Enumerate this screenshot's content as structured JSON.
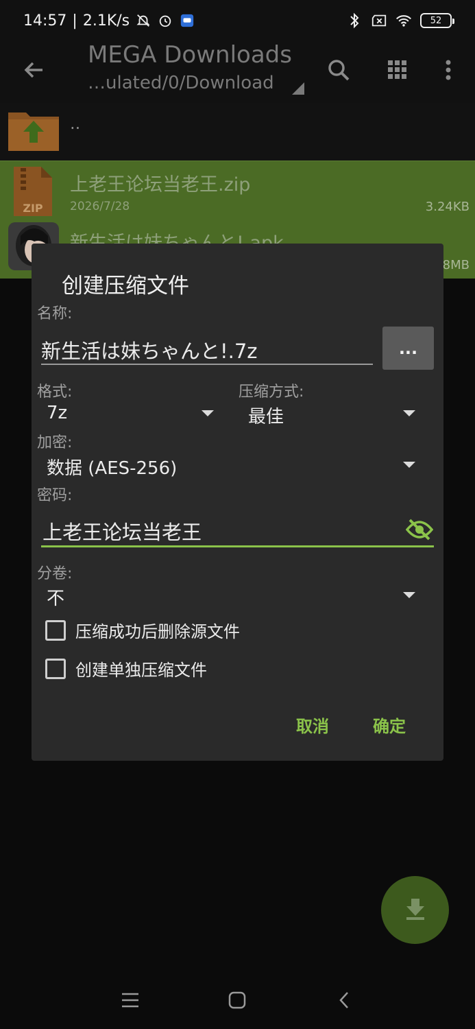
{
  "status_bar": {
    "time": "14:57",
    "net_speed": "2.1K/s",
    "battery": "52",
    "icons": [
      "bell-off-icon",
      "alarm-icon",
      "app-badge-icon",
      "bluetooth-icon",
      "sim-x-icon",
      "wifi-icon",
      "battery-icon"
    ]
  },
  "toolbar": {
    "title": "MEGA Downloads",
    "path": "…ulated/0/Download",
    "icons": [
      "back-arrow-icon",
      "search-icon",
      "grid-view-icon",
      "more-vert-icon"
    ]
  },
  "file_list": {
    "parent_label": "..",
    "files": [
      {
        "name": "上老王论坛当老王.zip",
        "date": "2026/7/28",
        "size": "3.24KB",
        "icon": "zip-file-icon"
      },
      {
        "name": "新生活は妹ちゃんと!.apk",
        "date": "",
        "size": "8MB",
        "icon": "app-thumbnail-icon"
      }
    ]
  },
  "dialog": {
    "title": "创建压缩文件",
    "name_label": "名称:",
    "name_value": "新生活は妹ちゃんと!.7z",
    "browse_label": "...",
    "format_label": "格式:",
    "format_value": "7z",
    "method_label": "压缩方式:",
    "method_value": "最佳",
    "encryption_label": "加密:",
    "encryption_value": "数据 (AES-256)",
    "password_label": "密码:",
    "password_value": "上老王论坛当老王",
    "split_label": "分卷:",
    "split_value": "不",
    "checkbox_delete": "压缩成功后删除源文件",
    "checkbox_separate": "创建单独压缩文件",
    "cancel_label": "取消",
    "ok_label": "确定"
  },
  "colors": {
    "accent": "#8bc34a",
    "selected_row": "#4b6b25",
    "dialog_bg": "#2a2a2a",
    "fab_bg": "#3d5a1d"
  }
}
